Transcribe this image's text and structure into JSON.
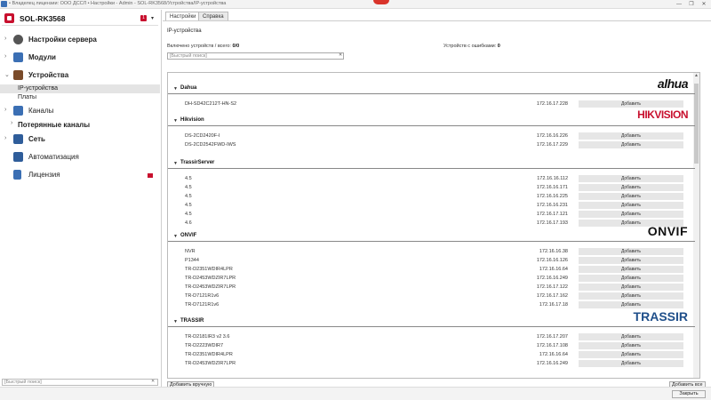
{
  "window": {
    "title": "• Владелец лицензии: ООО ДССЛ • Настройки - Admin - SOL-RK3568/Устройства/IP-устройства",
    "controls": [
      "—",
      "❐",
      "✕"
    ]
  },
  "sidebar": {
    "server_name": "SOL-RK3568",
    "server_badge": "1",
    "items": [
      {
        "label": "Настройки сервера",
        "bold": true
      },
      {
        "label": "Модули",
        "bold": true
      },
      {
        "label": "Устройства",
        "bold": true
      },
      {
        "label": "Каналы",
        "bold": false
      },
      {
        "label": "Потерянные каналы",
        "bold": true
      },
      {
        "label": "Сеть",
        "bold": true
      },
      {
        "label": "Автоматизация",
        "bold": false
      },
      {
        "label": "Лицензия",
        "bold": false
      }
    ],
    "subitems": [
      "IP-устройства",
      "Платы"
    ],
    "search_placeholder": "[Быстрый поиск]"
  },
  "tabs": [
    {
      "label": "Настройки",
      "active": true
    },
    {
      "label": "Справка",
      "active": false
    }
  ],
  "main": {
    "section_title": "IP-устройства",
    "enabled_label": "Включено устройств / всего:",
    "enabled_value": "0/0",
    "errors_label": "Устройств с ошибками:",
    "errors_value": "0",
    "search_placeholder": "[Быстрый поиск]",
    "add_label": "Добавить",
    "manual_add_label": "Добавить вручную",
    "add_all_label": "Добавить все",
    "close_label": "Закрыть"
  },
  "vendors": [
    {
      "name": "Dahua",
      "logo": "alhua",
      "devices": [
        {
          "model": "DH-SD42C212T-HN-S2",
          "ip": "172.16.17.228"
        }
      ]
    },
    {
      "name": "Hikvision",
      "logo": "HIKVISION",
      "devices": [
        {
          "model": "DS-2CD2420F-I",
          "ip": "172.16.16.226"
        },
        {
          "model": "DS-2CD2542FWD-IWS",
          "ip": "172.16.17.229"
        }
      ]
    },
    {
      "name": "TrassirServer",
      "logo": "",
      "devices": [
        {
          "model": "4.5",
          "ip": "172.16.16.112"
        },
        {
          "model": "4.5",
          "ip": "172.16.16.171"
        },
        {
          "model": "4.5",
          "ip": "172.16.16.225"
        },
        {
          "model": "4.5",
          "ip": "172.16.16.231"
        },
        {
          "model": "4.5",
          "ip": "172.16.17.121"
        },
        {
          "model": "4.6",
          "ip": "172.16.17.193"
        }
      ]
    },
    {
      "name": "ONVIF",
      "logo": "ONVIF",
      "devices": [
        {
          "model": "NVR",
          "ip": "172.16.16.38"
        },
        {
          "model": "P1344",
          "ip": "172.16.16.126"
        },
        {
          "model": "TR-D2351WDIR4LPR",
          "ip": "172.16.16.64"
        },
        {
          "model": "TR-D2453WDZIR7LPR",
          "ip": "172.16.16.249"
        },
        {
          "model": "TR-D2453WDZIR7LPR",
          "ip": "172.16.17.122"
        },
        {
          "model": "TR-D7121R1v6",
          "ip": "172.16.17.162"
        },
        {
          "model": "TR-D7121R1v6",
          "ip": "172.16.17.18"
        }
      ]
    },
    {
      "name": "TRASSIR",
      "logo": "TRASSIR",
      "devices": [
        {
          "model": "TR-D2181IR3 v2 3.6",
          "ip": "172.16.17.207"
        },
        {
          "model": "TR-D2223WDIR7",
          "ip": "172.16.17.108"
        },
        {
          "model": "TR-D2351WDIR4LPR",
          "ip": "172.16.16.64"
        },
        {
          "model": "TR-D2453WDZIR7LPR",
          "ip": "172.16.16.249"
        }
      ]
    }
  ],
  "colors": {
    "accent": "#c8102e",
    "selected_bg": "#e4e4e4",
    "button_bg": "#e6e6e6"
  }
}
